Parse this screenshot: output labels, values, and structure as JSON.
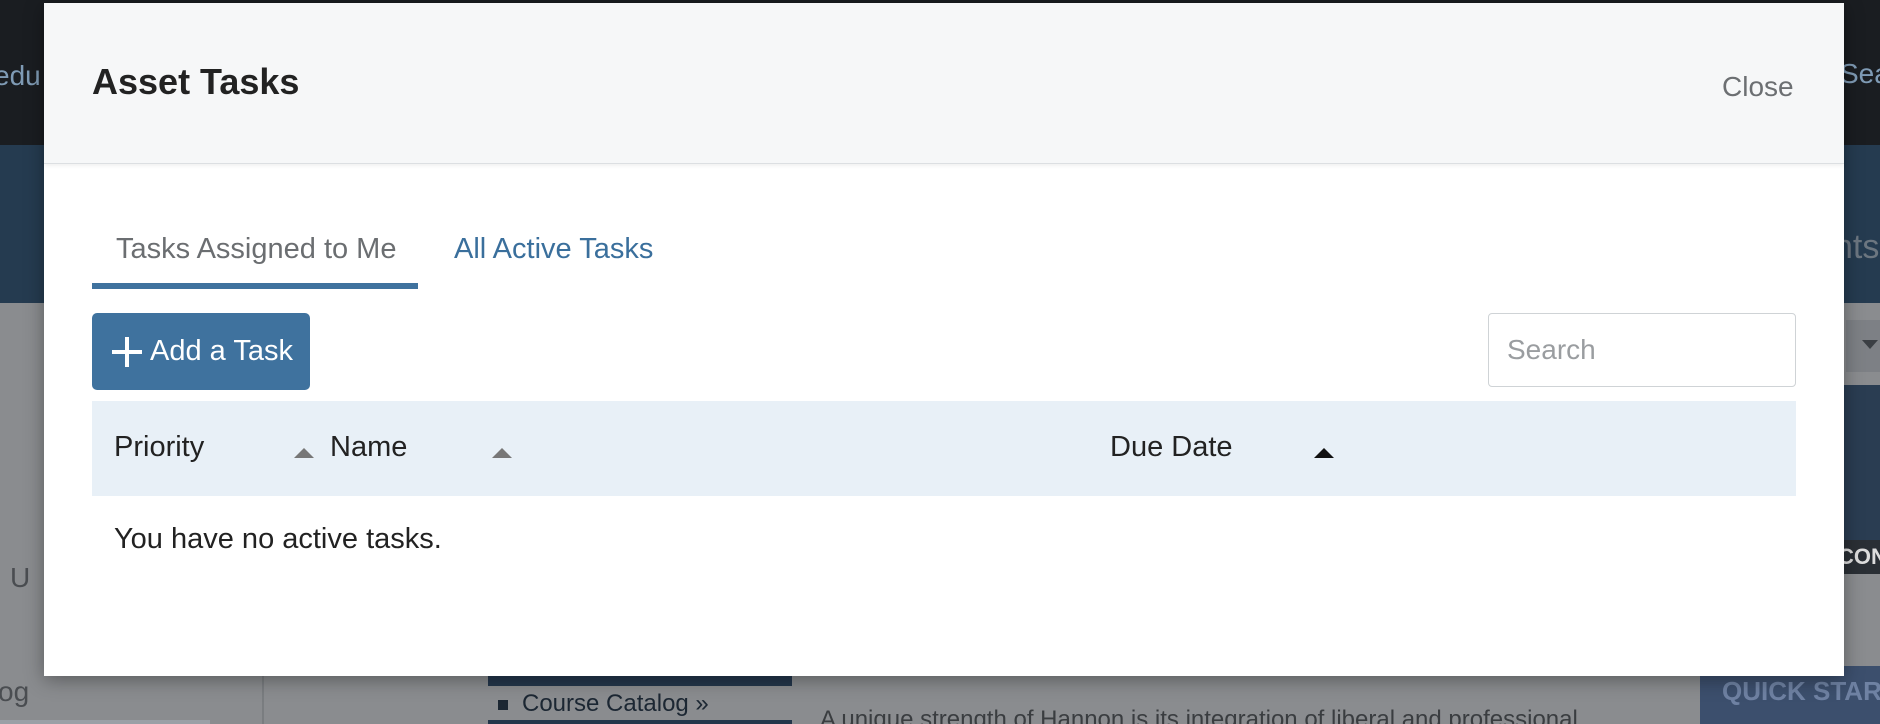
{
  "background": {
    "left_nav_fragment": "edu",
    "right_nav_fragment": "Sea",
    "right_banner_fragment": "nts",
    "right_dark_fragment": "CON",
    "left_fragment_u": "U",
    "left_fragment_og": "og",
    "quick_start_fragment": "QUICK STAR",
    "course_catalog_link": "Course Catalog »",
    "body_text_fragment": "A unique strength of Hannon is its integration of liberal and professional"
  },
  "modal": {
    "title": "Asset Tasks",
    "close_label": "Close",
    "tabs": [
      {
        "label": "Tasks Assigned to Me",
        "active": true
      },
      {
        "label": "All Active Tasks",
        "active": false
      }
    ],
    "add_task_label": "Add a Task",
    "search": {
      "placeholder": "Search",
      "value": ""
    },
    "table": {
      "columns": [
        "Priority",
        "Name",
        "Due Date"
      ],
      "rows": [],
      "empty_message": "You have no active tasks."
    }
  },
  "colors": {
    "accent": "#3f729e",
    "tab_link": "#3a6f9c",
    "table_header_bg": "#e8f0f7",
    "modal_header_bg": "#f6f7f8"
  }
}
